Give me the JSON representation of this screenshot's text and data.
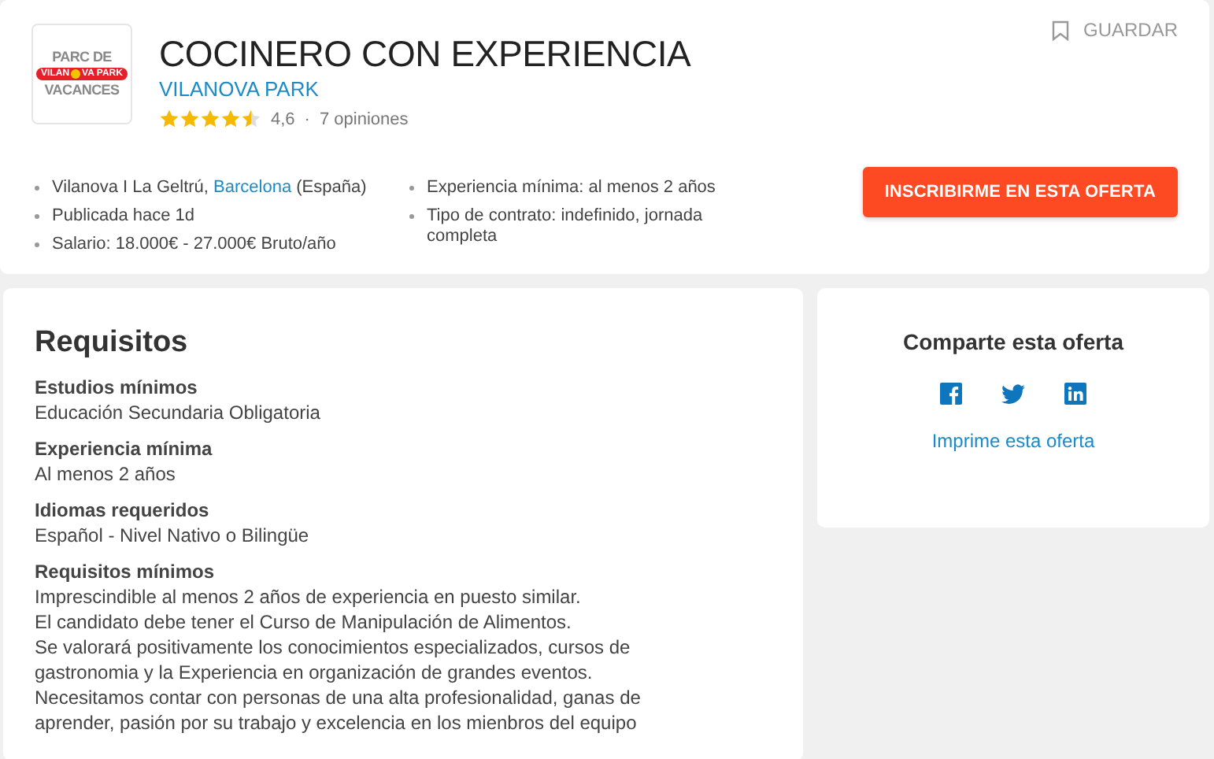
{
  "header": {
    "logo": {
      "top": "PARC DE",
      "band_left": "VILAN",
      "band_right": "VA PARK",
      "bottom": "VACANCES"
    },
    "title": "COCINERO CON EXPERIENCIA",
    "company": "VILANOVA PARK",
    "stars": 4.5,
    "rating": "4,6",
    "separator": "·",
    "reviews": "7 opiniones",
    "save": "GUARDAR",
    "details_left": [
      {
        "text": "Vilanova I La Geltrú, ",
        "link": "Barcelona",
        "suffix": " (España)"
      },
      {
        "text": "Publicada hace 1d"
      },
      {
        "text": "Salario: 18.000€ - 27.000€ Bruto/año"
      }
    ],
    "details_right": [
      {
        "text": "Experiencia mínima: al menos 2 años"
      },
      {
        "text": "Tipo de contrato: indefinido, jornada completa"
      }
    ],
    "apply_button": "INSCRIBIRME EN ESTA OFERTA"
  },
  "requirements": {
    "title": "Requisitos",
    "sections": [
      {
        "label": "Estudios mínimos",
        "lines": [
          "Educación Secundaria Obligatoria"
        ]
      },
      {
        "label": "Experiencia mínima",
        "lines": [
          "Al menos 2 años"
        ]
      },
      {
        "label": "Idiomas requeridos",
        "lines": [
          "Español - Nivel Nativo o Bilingüe"
        ]
      },
      {
        "label": "Requisitos mínimos",
        "lines": [
          "Imprescindible al menos 2 años de experiencia en puesto similar.",
          "El candidato debe tener el Curso de Manipulación de Alimentos.",
          "Se valorará positivamente los conocimientos especializados, cursos de gastronomia y la Experiencia en organización de grandes eventos.",
          "Necesitamos contar con personas de una alta profesionalidad, ganas de aprender, pasión por su trabajo y excelencia en los mienbros del equipo"
        ]
      }
    ]
  },
  "share": {
    "title": "Comparte esta oferta",
    "networks": [
      {
        "kind": "facebook"
      },
      {
        "kind": "twitter"
      },
      {
        "kind": "linkedin"
      }
    ],
    "print_link": "Imprime esta oferta"
  }
}
